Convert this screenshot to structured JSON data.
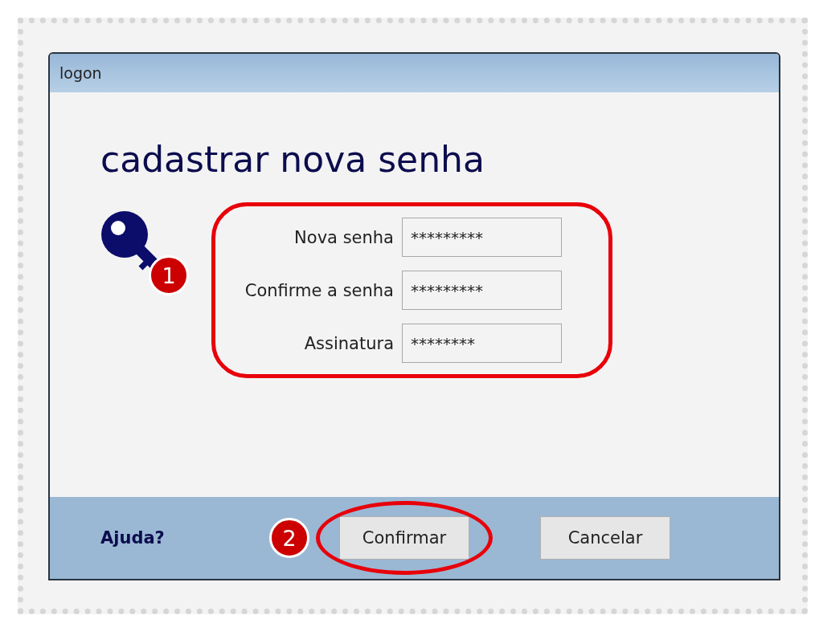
{
  "window": {
    "title": "logon"
  },
  "heading": "cadastrar nova senha",
  "fields": [
    {
      "label": "Nova senha",
      "value": "*********"
    },
    {
      "label": "Confirme a senha",
      "value": "*********"
    },
    {
      "label": "Assinatura",
      "value": "********"
    }
  ],
  "markers": [
    "1",
    "2"
  ],
  "footer": {
    "help_link": "Ajuda?",
    "buttons": [
      {
        "label": "Confirmar",
        "highlighted": true
      },
      {
        "label": "Cancelar",
        "highlighted": false
      }
    ]
  }
}
